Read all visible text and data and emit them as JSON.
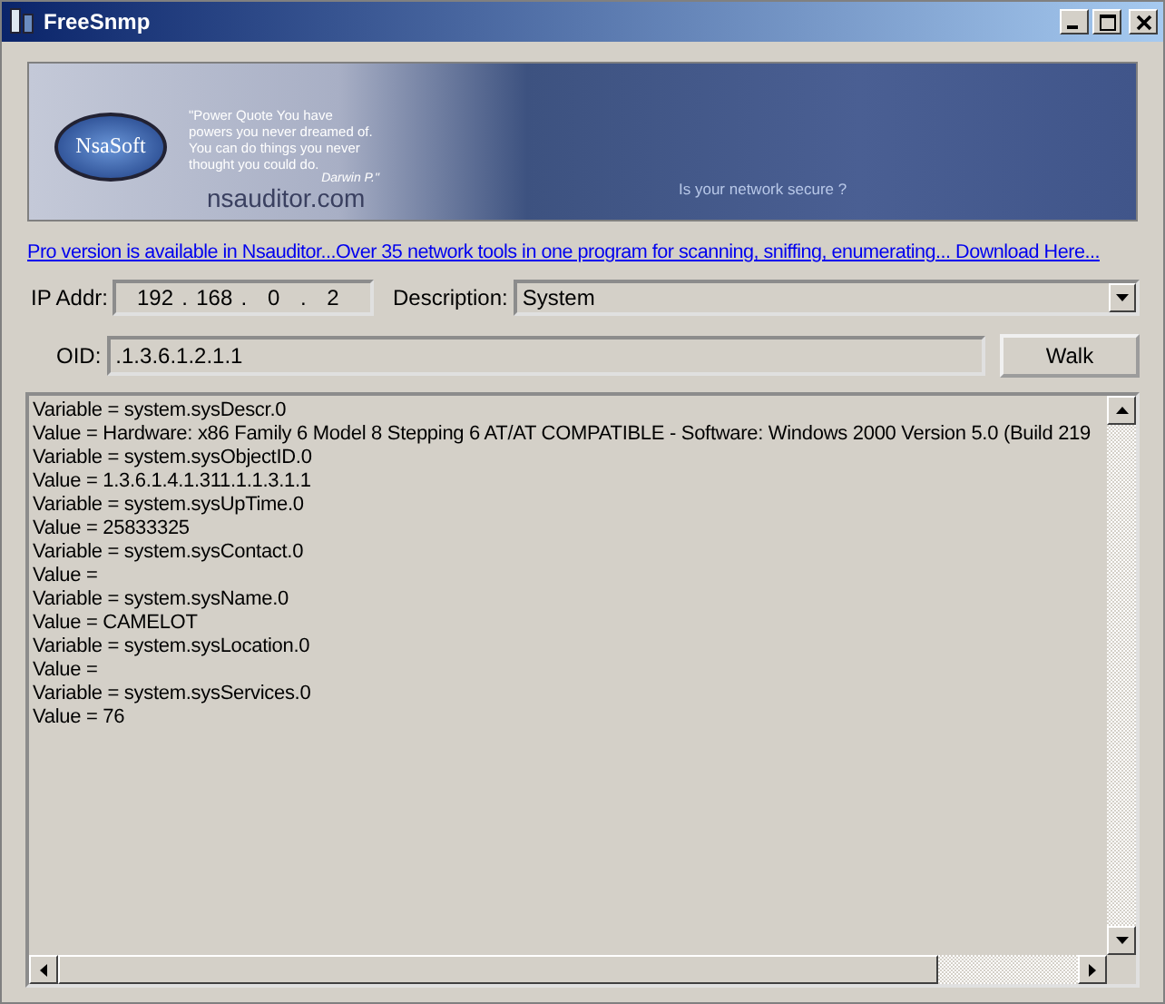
{
  "window": {
    "title": "FreeSnmp"
  },
  "banner": {
    "logo": "NsaSoft",
    "quote": "\"Power Quote You have powers you never dreamed of. You can do things you never thought you could do.",
    "author": "Darwin P.\"",
    "site": "nsauditor.com",
    "tagline": "Is your network secure ?"
  },
  "promo_link": "Pro version is available in Nsauditor...Over 35 network tools in one program for scanning, sniffing, enumerating... Download Here...",
  "ip": {
    "label": "IP Addr:",
    "parts": [
      {
        "kind": "octet",
        "text": "192"
      },
      {
        "kind": "dot",
        "text": "."
      },
      {
        "kind": "octet",
        "text": "168"
      },
      {
        "kind": "dot",
        "text": "."
      },
      {
        "kind": "octet",
        "text": "0"
      },
      {
        "kind": "dot",
        "text": "."
      },
      {
        "kind": "octet",
        "text": "2"
      }
    ]
  },
  "description": {
    "label": "Description:",
    "value": "System"
  },
  "oid": {
    "label": "OID:",
    "value": ".1.3.6.1.2.1.1"
  },
  "walk_button": "Walk",
  "output_lines": [
    "Variable = system.sysDescr.0",
    "Value  = Hardware: x86 Family 6 Model 8 Stepping 6 AT/AT COMPATIBLE - Software: Windows 2000 Version 5.0 (Build 219",
    "Variable = system.sysObjectID.0",
    "Value  = 1.3.6.1.4.1.311.1.1.3.1.1",
    "Variable = system.sysUpTime.0",
    "Value  = 25833325",
    "Variable = system.sysContact.0",
    "Value  =",
    "Variable = system.sysName.0",
    "Value  = CAMELOT",
    "Variable = system.sysLocation.0",
    "Value  =",
    "Variable = system.sysServices.0",
    "Value  = 76"
  ]
}
